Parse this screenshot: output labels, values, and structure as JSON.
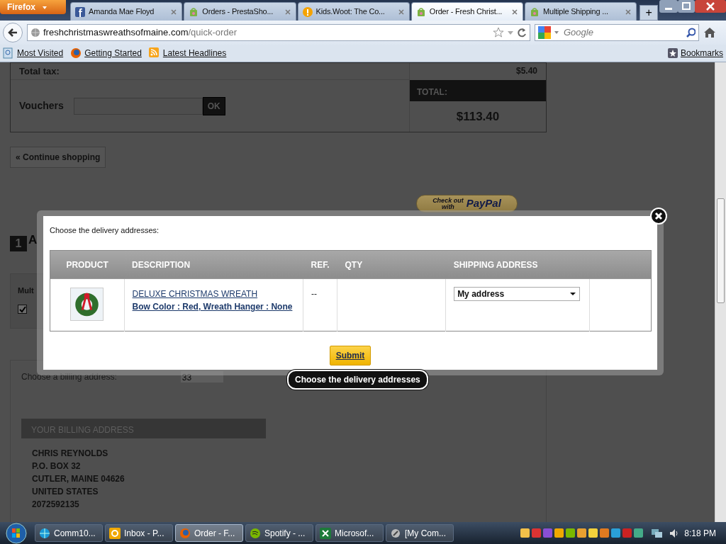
{
  "browser": {
    "firefox_button": "Firefox",
    "tabs": [
      {
        "label": "Amanda Mae Floyd",
        "kind": "facebook",
        "selected": false
      },
      {
        "label": "Orders - PrestaSho...",
        "kind": "shop",
        "selected": false
      },
      {
        "label": "Kids.Woot: The Co...",
        "kind": "alert",
        "selected": false
      },
      {
        "label": "Order - Fresh Christ...",
        "kind": "shop",
        "selected": true
      },
      {
        "label": "Multiple Shipping ...",
        "kind": "shop",
        "selected": false
      }
    ],
    "new_tab": "+",
    "url_domain": "freshchristmaswreathsofmaine.com",
    "url_path": "/quick-order",
    "search_placeholder": "Google",
    "bookmarks": [
      {
        "label": "Most Visited",
        "kind": "page"
      },
      {
        "label": "Getting Started",
        "kind": "firefox"
      },
      {
        "label": "Latest Headlines",
        "kind": "feed"
      }
    ],
    "bookmarks_menu": "Bookmarks"
  },
  "page": {
    "total_tax_label": "Total tax:",
    "total_tax_value": "$5.40",
    "vouchers_label": "Vouchers",
    "voucher_button": "OK",
    "total_label": "TOTAL:",
    "total_value": "$113.40",
    "continue_button": "« Continue shopping",
    "paypal_button": {
      "line1": "Check out",
      "line2": "with",
      "brand": "PayPal"
    },
    "step_number": "1",
    "step_title": "A",
    "multi_label": "Mult",
    "multi_checked": true,
    "billing_prompt": "Choose a billing address:",
    "billing_select": "33",
    "billing_header": "YOUR BILLING ADDRESS",
    "billing_lines": [
      "CHRIS REYNOLDS",
      "P.O. BOX 32",
      "CUTLER, MAINE 04626",
      "UNITED STATES",
      "2072592135"
    ]
  },
  "modal": {
    "prompt": "Choose the delivery addresses:",
    "columns": [
      "PRODUCT",
      "DESCRIPTION",
      "REF.",
      "QTY",
      "SHIPPING ADDRESS"
    ],
    "rows": [
      {
        "name": "DELUXE CHRISTMAS WREATH",
        "attributes": "Bow Color : Red, Wreath Hanger : None",
        "ref": "--",
        "address": "My address"
      }
    ],
    "submit": "Submit",
    "tooltip": "Choose the delivery addresses"
  },
  "taskbar": {
    "items": [
      {
        "label": "Comm10...",
        "kind": "globe",
        "selected": false
      },
      {
        "label": "Inbox - P...",
        "kind": "outlook",
        "selected": false
      },
      {
        "label": "Order - F...",
        "kind": "firefox",
        "selected": true
      },
      {
        "label": "Spotify - ...",
        "kind": "spotify",
        "selected": false
      },
      {
        "label": "Microsof...",
        "kind": "excel",
        "selected": false
      },
      {
        "label": "[My Com...",
        "kind": "app",
        "selected": false
      }
    ],
    "clock": "8:18 PM"
  }
}
